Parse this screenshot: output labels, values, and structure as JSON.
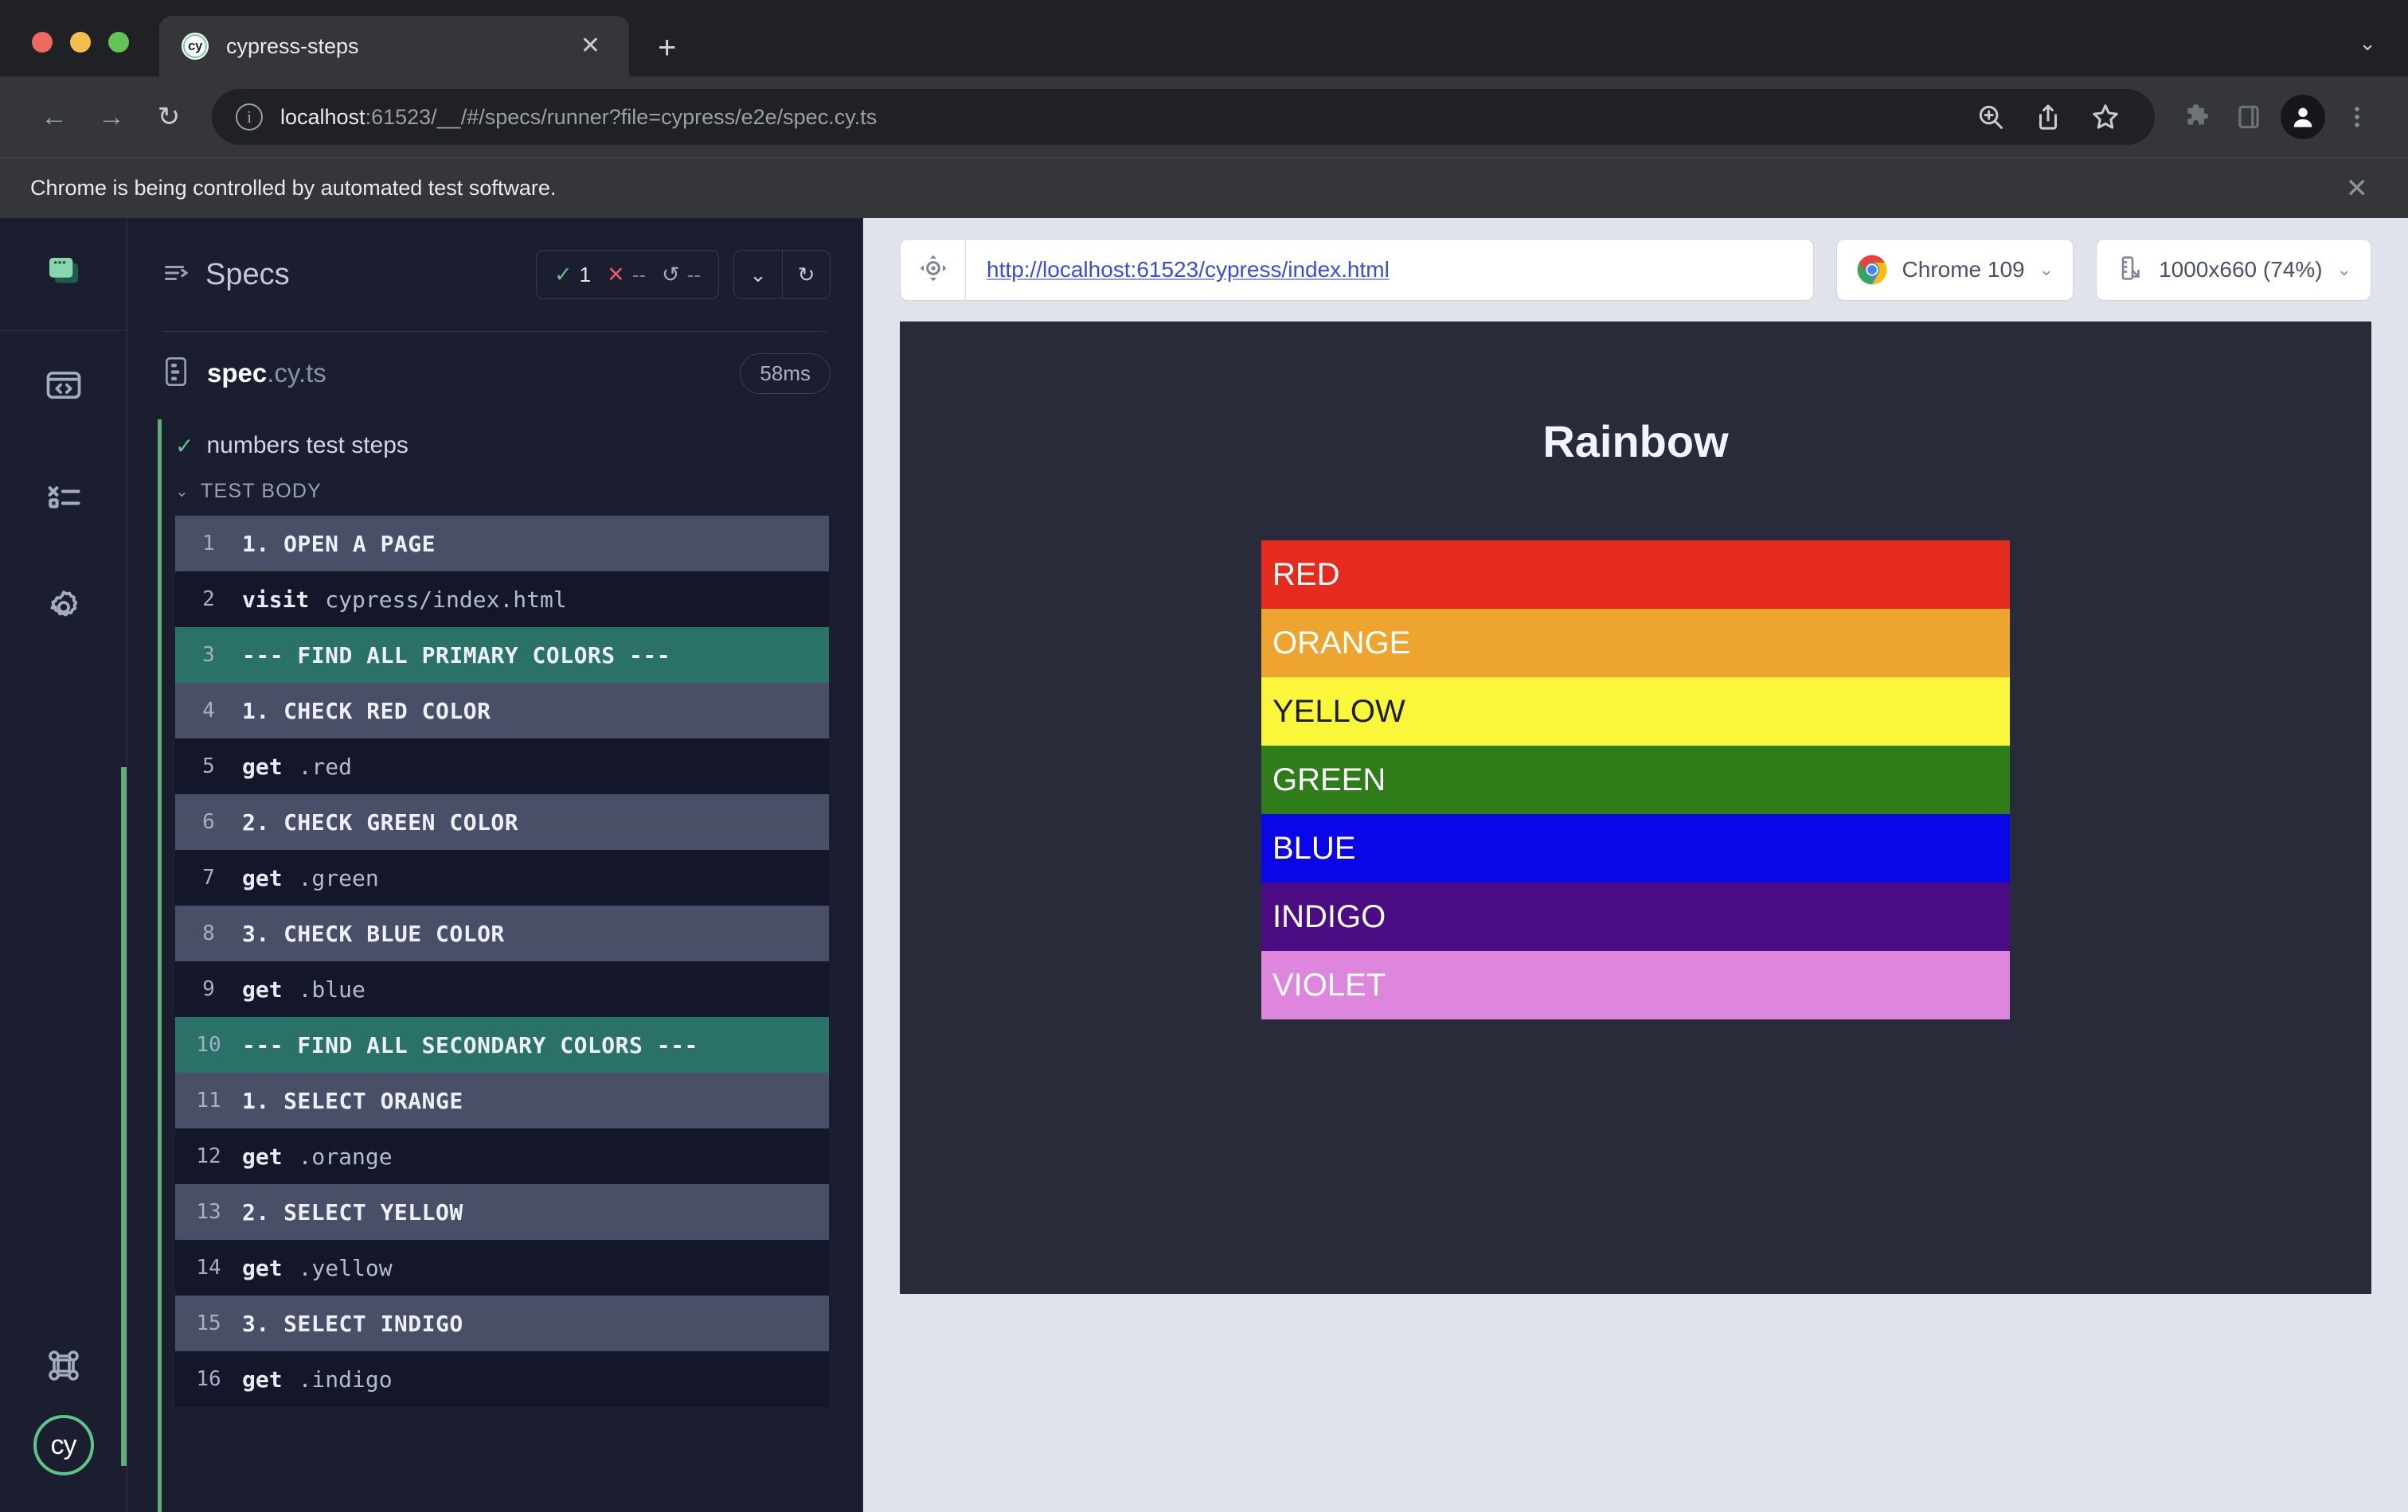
{
  "browser": {
    "tab": {
      "title": "cypress-steps",
      "favicon_text": "cy",
      "favicon_name": "cypress-favicon",
      "close_label": "✕"
    },
    "new_tab_label": "+",
    "tabstrip_caret": "⌄",
    "nav": {
      "back": "←",
      "forward": "→",
      "reload": "↻"
    },
    "omnibox": {
      "info_glyph": "i",
      "url_host": "localhost",
      "url_rest": ":61523/__/#/specs/runner?file=cypress/e2e/spec.cy.ts"
    },
    "toolbar_icons": [
      "zoom-in-icon",
      "share-icon",
      "bookmark-star-icon",
      "extensions-puzzle-icon",
      "side-panel-icon",
      "profile-avatar-icon",
      "chrome-menu-icon"
    ],
    "notification": {
      "text": "Chrome is being controlled by automated test software.",
      "close_label": "✕"
    }
  },
  "rail": {
    "items": [
      {
        "name": "projects-icon",
        "label": "Projects"
      },
      {
        "name": "specs-code-icon",
        "label": "Specs"
      },
      {
        "name": "runs-list-icon",
        "label": "Runs"
      },
      {
        "name": "settings-gear-icon",
        "label": "Settings"
      },
      {
        "name": "keyboard-shortcuts-icon",
        "label": "Keyboard Shortcuts"
      }
    ],
    "logo_text": "cy"
  },
  "reporter": {
    "title": "Specs",
    "stats": {
      "passed": {
        "icon": "✓",
        "value": "1"
      },
      "failed": {
        "icon": "✕",
        "value": "--"
      },
      "pending": {
        "icon": "↺",
        "value": "--"
      }
    },
    "buttons": {
      "collapse": "⌄",
      "rerun": "↻"
    },
    "spec": {
      "name": "spec",
      "extension": ".cy.ts",
      "duration": "58ms"
    },
    "test": {
      "status_icon": "✓",
      "title": "numbers test steps"
    },
    "test_body_label": "TEST BODY",
    "test_body_caret": "⌄",
    "steps": [
      {
        "n": "1",
        "type": "label",
        "text": "1. OPEN A PAGE"
      },
      {
        "n": "2",
        "type": "cmd",
        "cmd": "visit",
        "arg": "cypress/index.html"
      },
      {
        "n": "3",
        "type": "accent",
        "text": "--- FIND ALL PRIMARY COLORS ---"
      },
      {
        "n": "4",
        "type": "label",
        "text": "1. CHECK RED COLOR"
      },
      {
        "n": "5",
        "type": "cmd",
        "cmd": "get",
        "arg": ".red"
      },
      {
        "n": "6",
        "type": "label",
        "text": "2. CHECK GREEN COLOR"
      },
      {
        "n": "7",
        "type": "cmd",
        "cmd": "get",
        "arg": ".green"
      },
      {
        "n": "8",
        "type": "label",
        "text": "3. CHECK BLUE COLOR"
      },
      {
        "n": "9",
        "type": "cmd",
        "cmd": "get",
        "arg": ".blue"
      },
      {
        "n": "10",
        "type": "accent",
        "text": "--- FIND ALL SECONDARY COLORS ---"
      },
      {
        "n": "11",
        "type": "label",
        "text": "1. SELECT ORANGE"
      },
      {
        "n": "12",
        "type": "cmd",
        "cmd": "get",
        "arg": ".orange"
      },
      {
        "n": "13",
        "type": "label",
        "text": "2. SELECT YELLOW"
      },
      {
        "n": "14",
        "type": "cmd",
        "cmd": "get",
        "arg": ".yellow"
      },
      {
        "n": "15",
        "type": "label",
        "text": "3. SELECT INDIGO"
      },
      {
        "n": "16",
        "type": "cmd",
        "cmd": "get",
        "arg": ".indigo"
      }
    ]
  },
  "preview": {
    "selector_playground_icon": "crosshair-icon",
    "url": "http://localhost:61523/cypress/index.html",
    "browser_select": {
      "label": "Chrome 109",
      "caret": "⌄"
    },
    "viewport_select": {
      "label": "1000x660 (74%)",
      "caret": "⌄",
      "icon": "ruler-icon"
    },
    "app": {
      "title": "Rainbow",
      "bars": [
        {
          "label": "RED",
          "color": "#E52B1E",
          "text_color": "#ffffff"
        },
        {
          "label": "ORANGE",
          "color": "#EDA52F",
          "text_color": "#ffffff"
        },
        {
          "label": "YELLOW",
          "color": "#FAF73A",
          "text_color": "#1B1E2E"
        },
        {
          "label": "GREEN",
          "color": "#2E7D19",
          "text_color": "#ffffff"
        },
        {
          "label": "BLUE",
          "color": "#0A06E8",
          "text_color": "#ffffff"
        },
        {
          "label": "INDIGO",
          "color": "#4B0B82",
          "text_color": "#ffffff"
        },
        {
          "label": "VIOLET",
          "color": "#DE86DE",
          "text_color": "#ffffff"
        }
      ]
    }
  },
  "colors": {
    "cypress_green": "#5FC487",
    "accent_teal": "#2A7268",
    "panel_bg": "#1B1E2E",
    "step_alt": "#4A4F68",
    "preview_bg": "#E0E3EB",
    "link_blue": "#3A4CE0"
  }
}
